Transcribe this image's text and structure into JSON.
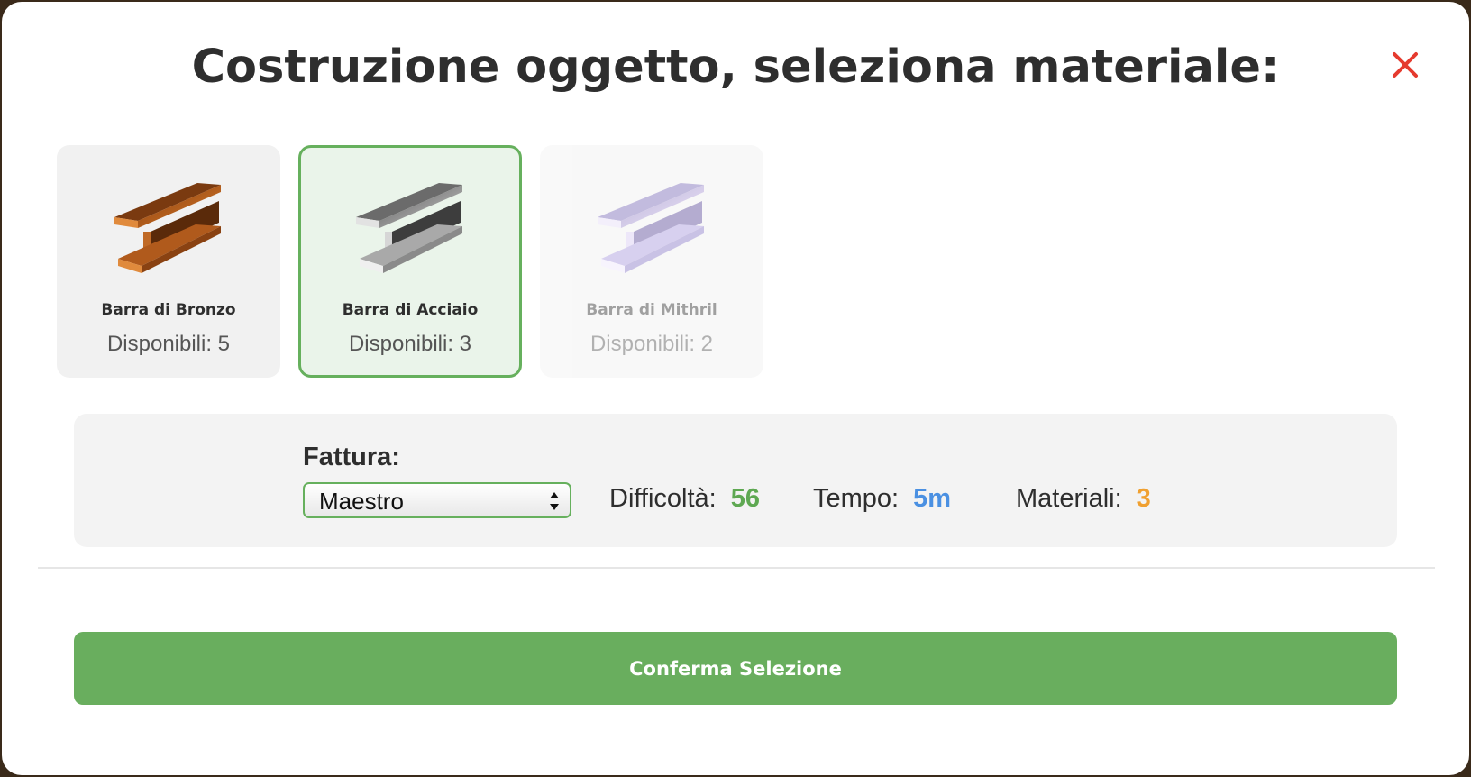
{
  "modal": {
    "title": "Costruzione oggetto, seleziona materiale:",
    "close_icon": "close-icon",
    "close_color": "#e53a2e"
  },
  "materials": [
    {
      "name": "Barra di Bronzo",
      "available": "Disponibili: 5",
      "color": "#c2661f",
      "state": "normal"
    },
    {
      "name": "Barra di Acciaio",
      "available": "Disponibili: 3",
      "color": "#9a9a9a",
      "state": "selected"
    },
    {
      "name": "Barra di Mithril",
      "available": "Disponibili: 2",
      "color": "#9c85d6",
      "state": "disabled"
    }
  ],
  "crafting": {
    "quality_label": "Fattura:",
    "quality_value": "Maestro",
    "difficulty_label": "Difficoltà:",
    "difficulty_value": "56",
    "time_label": "Tempo:",
    "time_value": "5m",
    "materials_label": "Materiali:",
    "materials_value": "3"
  },
  "colors": {
    "accent_green": "#69ae5e",
    "difficulty": "#5ea852",
    "time": "#4a90e2",
    "materials": "#f0a030"
  },
  "confirm_label": "Conferma Selezione"
}
